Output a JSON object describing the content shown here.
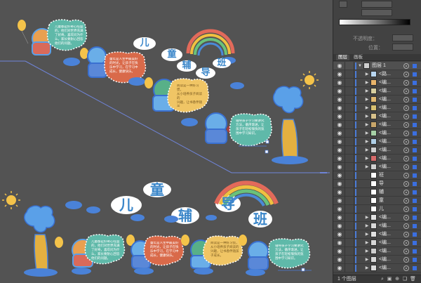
{
  "canvas": {
    "bubble_text_lines": [
      "儿童都是好奇心旺盛\n的，他们对世界充满\n了好奇，喜欢问为什\n么，家长要耐心回答\n他们的问题。",
      "童年是人生中最美好\n的时光，让孩子在快\n乐中学习，在学习中\n成长，健康快乐。",
      "阅读是一种好习惯，\n从小培养孩子阅读的\n兴趣，让书香伴随孩\n子成长。",
      "辅导孩子学习要讲究\n方法，循序渐进，让\n孩子在轻松愉快的氛\n围中学习知识。"
    ],
    "cloud_chars_top": [
      "儿",
      "童",
      "辅",
      "导",
      "班"
    ],
    "cloud_chars_bottom": [
      "儿",
      "童",
      "辅",
      "导",
      "班"
    ],
    "colors": {
      "accent": "#4a7bd8",
      "canvas_bg": "#535353",
      "panel_bg": "#424242"
    }
  },
  "properties": {
    "opacity_label": "不透明度：",
    "position_label": "位置："
  },
  "layers_panel": {
    "tabs": [
      "图层",
      "画板"
    ],
    "active_tab": "图层",
    "rows": [
      {
        "name": "图层 1",
        "expanded": true,
        "has_arrow": true,
        "thumb": "#cfcfcf",
        "top": true
      },
      {
        "name": "<路...",
        "has_arrow": true,
        "thumb": "#b8d6f0"
      },
      {
        "name": "<编...",
        "has_arrow": true,
        "thumb": "#e8b46a"
      },
      {
        "name": "<编...",
        "has_arrow": true,
        "thumb": "#d7cfa0"
      },
      {
        "name": "<编...",
        "has_arrow": true,
        "thumb": "#e0b870"
      },
      {
        "name": "<编...",
        "has_arrow": true,
        "thumb": "#d8c070"
      },
      {
        "name": "<编...",
        "has_arrow": true,
        "thumb": "#d6c08a"
      },
      {
        "name": "<编...",
        "has_arrow": true,
        "thumb": "#c8a66a"
      },
      {
        "name": "<编...",
        "has_arrow": true,
        "thumb": "#a6d0a6"
      },
      {
        "name": "<编...",
        "has_arrow": true,
        "thumb": "#b0cfe6"
      },
      {
        "name": "<编...",
        "has_arrow": true,
        "thumb": "#d0d0d0"
      },
      {
        "name": "<编...",
        "has_arrow": true,
        "thumb": "#d66a6a"
      },
      {
        "name": "<编...",
        "has_arrow": true,
        "thumb": "#d0d0d0"
      },
      {
        "name": "班",
        "has_arrow": false,
        "thumb": "#ffffff"
      },
      {
        "name": "导",
        "has_arrow": false,
        "thumb": "#ffffff"
      },
      {
        "name": "辅",
        "has_arrow": false,
        "thumb": "#ffffff"
      },
      {
        "name": "童",
        "has_arrow": false,
        "thumb": "#ffffff"
      },
      {
        "name": "儿",
        "has_arrow": false,
        "thumb": "#ffffff"
      },
      {
        "name": "<编...",
        "has_arrow": true,
        "thumb": "#e2e2e2"
      },
      {
        "name": "<编...",
        "has_arrow": true,
        "thumb": "#d8d8d8"
      },
      {
        "name": "<编...",
        "has_arrow": true,
        "thumb": "#e0e0e0"
      },
      {
        "name": "<编...",
        "has_arrow": true,
        "thumb": "#d6d6d6"
      },
      {
        "name": "<编...",
        "has_arrow": true,
        "thumb": "#cfcfcf"
      },
      {
        "name": "<编...",
        "has_arrow": true,
        "thumb": "#d9d9d9"
      },
      {
        "name": "<编...",
        "has_arrow": true,
        "thumb": "#dcdcdc"
      }
    ],
    "footer": {
      "count_label": "1 个图层"
    }
  }
}
